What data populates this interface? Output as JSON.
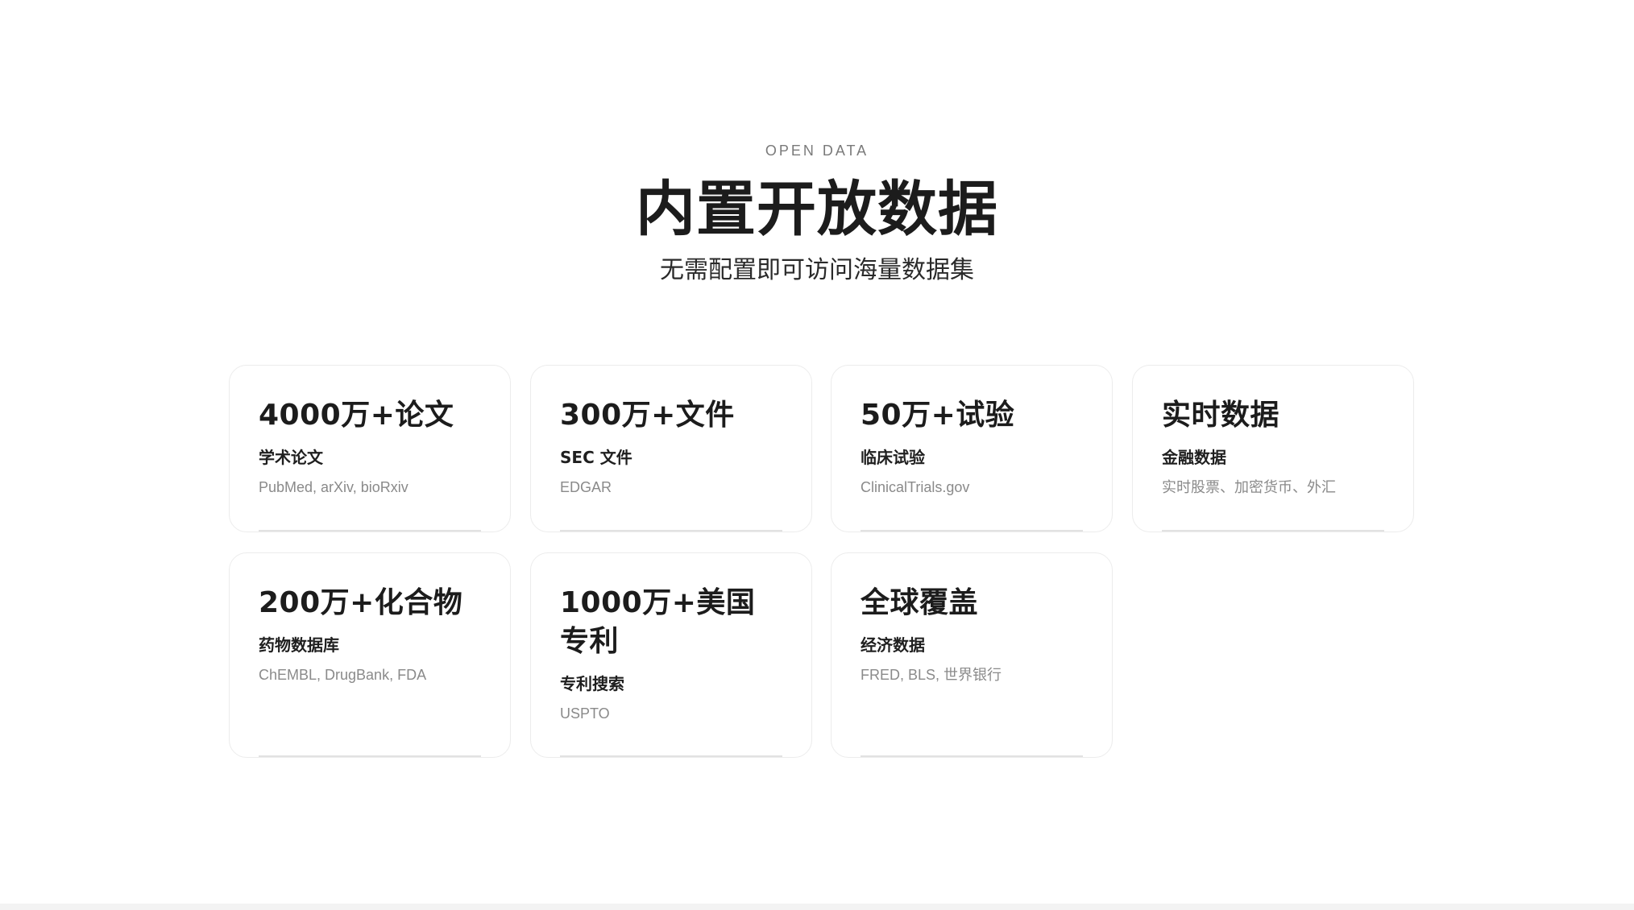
{
  "section": {
    "eyebrow": "OPEN DATA",
    "title": "内置开放数据",
    "subtitle": "无需配置即可访问海量数据集"
  },
  "cards": [
    {
      "stat": "4000万+论文",
      "label": "学术论文",
      "source": "PubMed, arXiv, bioRxiv"
    },
    {
      "stat": "300万+文件",
      "label": "SEC 文件",
      "source": "EDGAR"
    },
    {
      "stat": "50万+试验",
      "label": "临床试验",
      "source": "ClinicalTrials.gov"
    },
    {
      "stat": "实时数据",
      "label": "金融数据",
      "source": "实时股票、加密货币、外汇"
    },
    {
      "stat": "200万+化合物",
      "label": "药物数据库",
      "source": "ChEMBL, DrugBank, FDA"
    },
    {
      "stat": "1000万+美国专利",
      "label": "专利搜索",
      "source": "USPTO"
    },
    {
      "stat": "全球覆盖",
      "label": "经济数据",
      "source": "FRED, BLS, 世界银行"
    }
  ]
}
